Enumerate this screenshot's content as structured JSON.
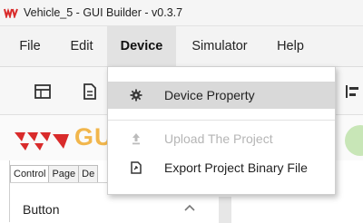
{
  "window": {
    "title": "Vehicle_5 - GUI Builder - v0.3.7"
  },
  "menubar": {
    "items": [
      {
        "label": "File"
      },
      {
        "label": "Edit"
      },
      {
        "label": "Device"
      },
      {
        "label": "Simulator"
      },
      {
        "label": "Help"
      }
    ],
    "active": "Device"
  },
  "toolbar": {
    "icons": [
      "table-icon",
      "document-icon",
      "align-icon"
    ]
  },
  "brand": {
    "text": "GU",
    "colors": {
      "red": "#d92b2b",
      "yellow": "#f1b64c"
    }
  },
  "device_menu": {
    "items": [
      {
        "label": "Device Property",
        "icon": "gear-icon",
        "state": "hover"
      },
      {
        "label": "Upload The Project",
        "icon": "upload-icon",
        "state": "disabled"
      },
      {
        "label": "Export Project Binary File",
        "icon": "file-export-icon",
        "state": "normal"
      }
    ]
  },
  "panel": {
    "tabs": [
      {
        "label": "Control"
      },
      {
        "label": "Page"
      },
      {
        "label": "De"
      }
    ],
    "active_tab": "Control",
    "section_label": "Button"
  }
}
